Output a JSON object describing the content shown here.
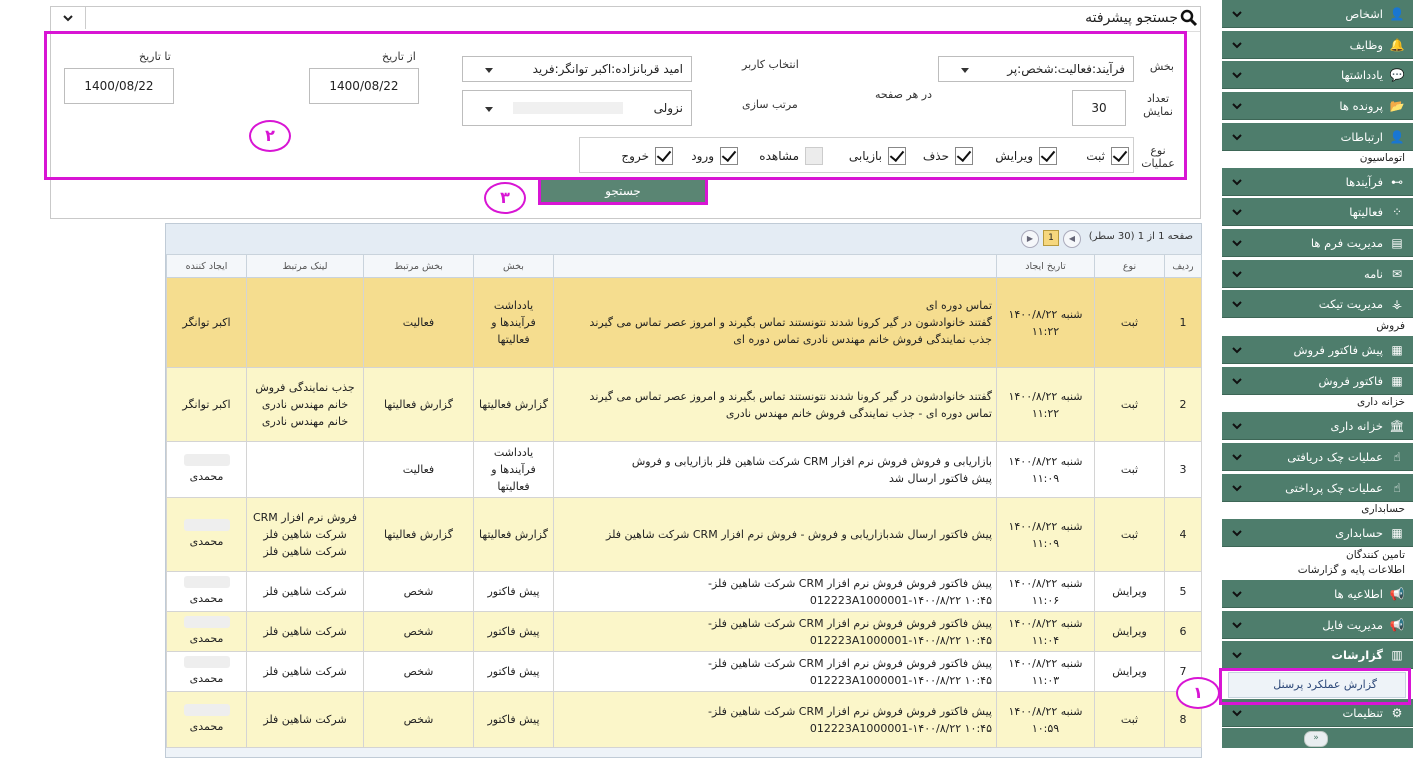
{
  "sidebar": {
    "items": [
      {
        "label": "اشخاص",
        "icon": "person-icon"
      },
      {
        "label": "وظایف",
        "icon": "bell-icon"
      },
      {
        "label": "یادداشتها",
        "icon": "comment-icon"
      },
      {
        "label": "پرونده ها",
        "icon": "folder-icon"
      },
      {
        "label": "ارتباطات",
        "icon": "person-icon"
      },
      {
        "label": "فرآیندها",
        "icon": "flow-icon"
      },
      {
        "label": "فعالیتها",
        "icon": "spinner-icon"
      },
      {
        "label": "مدیریت فرم ها",
        "icon": "form-icon"
      },
      {
        "label": "نامه",
        "icon": "mail-icon"
      },
      {
        "label": "مدیریت تیکت",
        "icon": "ticket-icon"
      },
      {
        "label": "پیش فاکتور فروش",
        "icon": "invoice-icon"
      },
      {
        "label": "فاکتور فروش",
        "icon": "invoice-icon"
      },
      {
        "label": "خزانه داری",
        "icon": "bank-icon"
      },
      {
        "label": "عملیات چک دریافتی",
        "icon": "hand-money-icon"
      },
      {
        "label": "عملیات چک پرداختی",
        "icon": "hand-money-icon"
      },
      {
        "label": "حسابداری",
        "icon": "calculator-icon"
      },
      {
        "label": "اطلاعیه ها",
        "icon": "megaphone-icon"
      },
      {
        "label": "مدیریت فایل",
        "icon": "megaphone-icon"
      },
      {
        "label": "گزارشات",
        "icon": "chart-icon"
      },
      {
        "label": "تنظیمات",
        "icon": "gear-icon"
      }
    ],
    "categories": {
      "automation": "اتوماسیون",
      "sales": "فروش",
      "treasury": "خزانه داری",
      "accounting": "حسابداری",
      "suppliers": "تامین کنندگان",
      "base_reports": "اطلاعات پایه و گزارشات"
    },
    "sub_item": "گزارش عملکرد پرسنل"
  },
  "search": {
    "title": "جستجو پیشرفته",
    "section_label": "بخش",
    "section_value": "فرآیند:فعالیت:شخص:پر",
    "user_label": "انتخاب کاربر",
    "user_value": "امید قربانزاده:اکبر توانگر:فرید",
    "from_label": "از تاریخ",
    "from_value": "1400/08/22",
    "to_label": "تا تاریخ",
    "to_value": "1400/08/22",
    "count_label": "تعداد نمایش",
    "count_value": "30",
    "per_page_label": "در هر صفحه",
    "sort_label": "مرتب سازی",
    "sort_value": "نزولی",
    "ops_label": "نوع عملیات",
    "ops": [
      {
        "label": "ثبت",
        "checked": true
      },
      {
        "label": "ویرایش",
        "checked": true
      },
      {
        "label": "حذف",
        "checked": true
      },
      {
        "label": "بازیابی",
        "checked": true
      },
      {
        "label": "مشاهده",
        "checked": false
      },
      {
        "label": "ورود",
        "checked": true
      },
      {
        "label": "خروج",
        "checked": true
      }
    ],
    "button": "جستجو"
  },
  "callouts": {
    "one": "۱",
    "two": "۲",
    "three": "۳"
  },
  "results": {
    "page_info": "صفحه 1 از 1 (30 سطر)",
    "page_number": "1",
    "columns": [
      "ردیف",
      "نوع",
      "تاریخ ایجاد",
      "",
      "بخش",
      "بخش مرتبط",
      "لینک مرتبط",
      "ایجاد کننده"
    ],
    "rows": [
      {
        "num": "1",
        "type": "ثبت",
        "date": "شنبه ۱۴۰۰/۸/۲۲ ۱۱:۲۲",
        "title": "تماس دوره ای",
        "desc": "گفتند خانوادشون در گیر کرونا شدند نتونستند تماس بگیرند و امروز عصر تماس می گیرند",
        "note": "جذب نمایندگی فروش خانم مهندس نادری تماس دوره ای",
        "section": "یادداشت فرآیندها و فعالیتها",
        "related_section": "فعالیت",
        "related_link": "",
        "creator": "اکبر توانگر"
      },
      {
        "num": "2",
        "type": "ثبت",
        "date": "شنبه ۱۴۰۰/۸/۲۲ ۱۱:۲۲",
        "title": "",
        "desc": "گفتند خانوادشون در گیر کرونا شدند نتونستند تماس بگیرند و امروز عصر تماس می گیرند",
        "note": "تماس دوره ای - جذب نمایندگی فروش خانم مهندس نادری",
        "section": "گزارش فعالیتها",
        "related_section": "گزارش فعالیتها",
        "related_link": "جذب نمایندگی فروش خانم مهندس نادری خانم مهندس نادری",
        "creator": "اکبر توانگر"
      },
      {
        "num": "3",
        "type": "ثبت",
        "date": "شنبه ۱۴۰۰/۸/۲۲ ۱۱:۰۹",
        "title": "",
        "desc": "بازاریابی و فروش فروش نرم افزار CRM شرکت شاهین فلز بازاریابی و فروش",
        "note": "پیش فاکتور ارسال شد",
        "section": "یادداشت فرآیندها و فعالیتها",
        "related_section": "فعالیت",
        "related_link": "",
        "creator": "محمدی"
      },
      {
        "num": "4",
        "type": "ثبت",
        "date": "شنبه ۱۴۰۰/۸/۲۲ ۱۱:۰۹",
        "title": "",
        "desc": "پیش فاکتور ارسال شدبازاریابی و فروش - فروش نرم افزار CRM شرکت شاهین فلز",
        "note": "",
        "section": "گزارش فعالیتها",
        "related_section": "گزارش فعالیتها",
        "related_link": "فروش نرم افزار CRM شرکت شاهین فلز شرکت شاهین فلز",
        "creator": "محمدی"
      },
      {
        "num": "5",
        "type": "ویرایش",
        "date": "شنبه ۱۴۰۰/۸/۲۲ ۱۱:۰۶",
        "title": "",
        "desc": "پیش فاکتور فروش فروش نرم افزار CRM شرکت شاهین فلز- 012223A1000001-۱۴۰۰/۸/۲۲ ۱۰:۴۵",
        "note": "",
        "section": "پیش فاکتور",
        "related_section": "شخص",
        "related_link": "شرکت شاهین فلز",
        "creator": "محمدی"
      },
      {
        "num": "6",
        "type": "ویرایش",
        "date": "شنبه ۱۴۰۰/۸/۲۲ ۱۱:۰۴",
        "title": "",
        "desc": "پیش فاکتور فروش فروش نرم افزار CRM شرکت شاهین فلز- 012223A1000001-۱۴۰۰/۸/۲۲ ۱۰:۴۵",
        "note": "",
        "section": "پیش فاکتور",
        "related_section": "شخص",
        "related_link": "شرکت شاهین فلز",
        "creator": "محمدی"
      },
      {
        "num": "7",
        "type": "ویرایش",
        "date": "شنبه ۱۴۰۰/۸/۲۲ ۱۱:۰۳",
        "title": "",
        "desc": "پیش فاکتور فروش فروش نرم افزار CRM شرکت شاهین فلز- 012223A1000001-۱۴۰۰/۸/۲۲ ۱۰:۴۵",
        "note": "",
        "section": "پیش فاکتور",
        "related_section": "شخص",
        "related_link": "شرکت شاهین فلز",
        "creator": "محمدی"
      },
      {
        "num": "8",
        "type": "ثبت",
        "date": "شنبه ۱۴۰۰/۸/۲۲ ۱۰:۵۹",
        "title": "",
        "desc": "پیش فاکتور فروش فروش نرم افزار CRM شرکت شاهین فلز- 012223A1000001-۱۴۰۰/۸/۲۲ ۱۰:۴۵",
        "note": "",
        "section": "پیش فاکتور",
        "related_section": "شخص",
        "related_link": "شرکت شاهین فلز",
        "creator": "محمدی"
      }
    ]
  },
  "colors": {
    "sidebar": "#4e7d6c",
    "highlight": "#d815d4",
    "row_yellow": "#fbf6c9",
    "row_orange": "#f5dd8f"
  }
}
